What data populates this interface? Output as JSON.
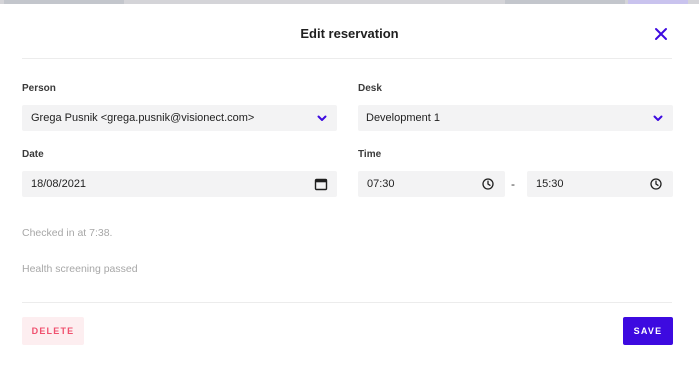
{
  "dialog": {
    "title": "Edit reservation",
    "close_icon": "close-icon"
  },
  "form": {
    "person": {
      "label": "Person",
      "value": "Grega Pusnik <grega.pusnik@visionect.com>",
      "icon": "chevron-down-icon"
    },
    "desk": {
      "label": "Desk",
      "value": "Development 1",
      "icon": "chevron-down-icon"
    },
    "date": {
      "label": "Date",
      "value": "18/08/2021",
      "icon": "calendar-icon"
    },
    "time": {
      "label": "Time",
      "start": "07:30",
      "end": "15:30",
      "separator": "-",
      "icon": "clock-icon"
    }
  },
  "info": {
    "checked_in": "Checked in at 7:38.",
    "health": "Health screening passed"
  },
  "actions": {
    "delete_label": "DELETE",
    "save_label": "SAVE"
  },
  "colors": {
    "accent": "#3d0ae0",
    "danger": "#f0506e",
    "danger_bg": "#fdeef0",
    "field_bg": "#f3f3f4",
    "muted_text": "#a7a7a7"
  }
}
